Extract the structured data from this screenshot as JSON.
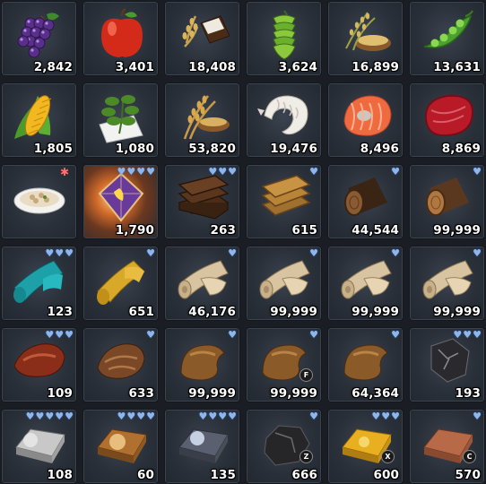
{
  "inventory": {
    "items": [
      {
        "name": "grapes",
        "quantity": "2,842",
        "grade": 0,
        "icon": "grapes-icon"
      },
      {
        "name": "apple",
        "quantity": "3,401",
        "grade": 0,
        "icon": "apple-icon"
      },
      {
        "name": "flour",
        "quantity": "18,408",
        "grade": 0,
        "icon": "flour-bowl-icon"
      },
      {
        "name": "hops",
        "quantity": "3,624",
        "grade": 0,
        "icon": "hops-icon"
      },
      {
        "name": "rice",
        "quantity": "16,899",
        "grade": 0,
        "icon": "rice-icon"
      },
      {
        "name": "peas",
        "quantity": "13,631",
        "grade": 0,
        "icon": "pea-pod-icon"
      },
      {
        "name": "corn",
        "quantity": "1,805",
        "grade": 0,
        "icon": "corn-icon"
      },
      {
        "name": "herbs",
        "quantity": "1,080",
        "grade": 0,
        "icon": "herb-icon"
      },
      {
        "name": "wheat",
        "quantity": "53,820",
        "grade": 0,
        "icon": "wheat-icon"
      },
      {
        "name": "shrimp",
        "quantity": "19,476",
        "grade": 0,
        "icon": "shrimp-icon"
      },
      {
        "name": "salmon",
        "quantity": "8,496",
        "grade": 0,
        "icon": "salmon-steak-icon"
      },
      {
        "name": "steak",
        "quantity": "8,869",
        "grade": 0,
        "icon": "steak-icon"
      },
      {
        "name": "soup",
        "quantity": "",
        "grade": 0,
        "icon": "soup-bowl-icon",
        "mark": "✱"
      },
      {
        "name": "crystal",
        "quantity": "1,790",
        "grade": 4,
        "icon": "crystal-icon",
        "glow": true
      },
      {
        "name": "dark planks",
        "quantity": "263",
        "grade": 3,
        "icon": "planks-icon"
      },
      {
        "name": "light planks",
        "quantity": "615",
        "grade": 1,
        "icon": "planks-icon"
      },
      {
        "name": "dark log",
        "quantity": "44,544",
        "grade": 1,
        "icon": "log-icon"
      },
      {
        "name": "log",
        "quantity": "99,999",
        "grade": 1,
        "icon": "log-icon"
      },
      {
        "name": "teal fabric",
        "quantity": "123",
        "grade": 3,
        "icon": "fabric-roll-icon"
      },
      {
        "name": "gold fabric",
        "quantity": "651",
        "grade": 1,
        "icon": "fabric-roll-icon"
      },
      {
        "name": "linen",
        "quantity": "46,176",
        "grade": 1,
        "icon": "cloth-roll-icon"
      },
      {
        "name": "linen",
        "quantity": "99,999",
        "grade": 1,
        "icon": "cloth-roll-icon"
      },
      {
        "name": "linen",
        "quantity": "99,999",
        "grade": 1,
        "icon": "cloth-roll-icon"
      },
      {
        "name": "linen",
        "quantity": "99,999",
        "grade": 1,
        "icon": "cloth-roll-icon"
      },
      {
        "name": "red leather",
        "quantity": "109",
        "grade": 3,
        "icon": "leather-icon"
      },
      {
        "name": "brown leather",
        "quantity": "633",
        "grade": 1,
        "icon": "leather-icon"
      },
      {
        "name": "hide",
        "quantity": "99,999",
        "grade": 1,
        "icon": "hide-icon"
      },
      {
        "name": "hide",
        "quantity": "99,999",
        "grade": 1,
        "icon": "hide-icon",
        "tag": "F"
      },
      {
        "name": "hide",
        "quantity": "64,364",
        "grade": 1,
        "icon": "hide-icon"
      },
      {
        "name": "black ore",
        "quantity": "193",
        "grade": 3,
        "icon": "ore-icon"
      },
      {
        "name": "silver ingot",
        "quantity": "108",
        "grade": 5,
        "icon": "ingot-icon"
      },
      {
        "name": "bronze ingot",
        "quantity": "60",
        "grade": 4,
        "icon": "ingot-icon"
      },
      {
        "name": "steel ingot",
        "quantity": "135",
        "grade": 4,
        "icon": "ingot-icon"
      },
      {
        "name": "coal",
        "quantity": "666",
        "grade": 1,
        "icon": "coal-icon",
        "tag": "Z"
      },
      {
        "name": "gold ingot",
        "quantity": "600",
        "grade": 3,
        "icon": "ingot-icon",
        "tag": "X"
      },
      {
        "name": "copper ingot",
        "quantity": "570",
        "grade": 1,
        "icon": "ingot-icon",
        "tag": "C"
      }
    ]
  }
}
